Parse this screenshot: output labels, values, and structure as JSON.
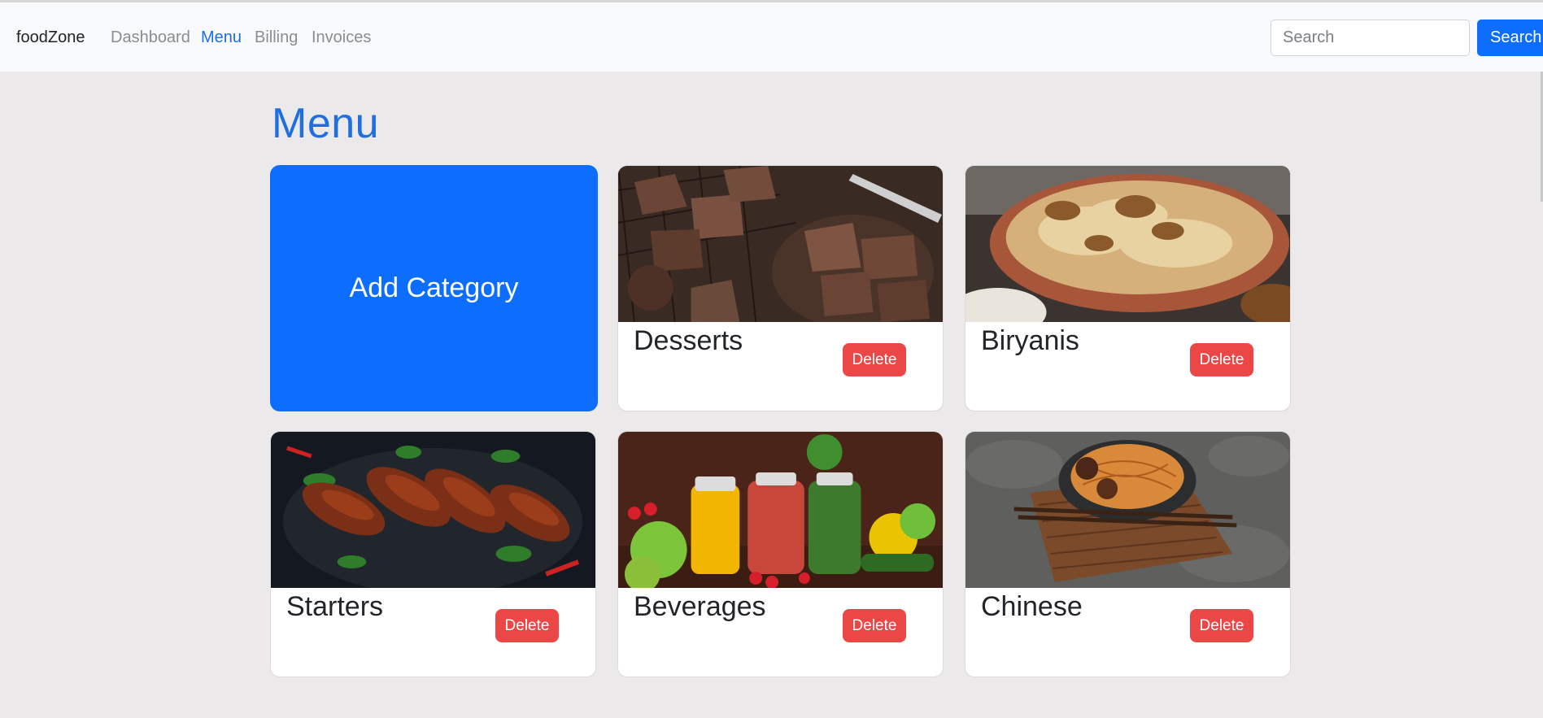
{
  "navbar": {
    "brand": "foodZone",
    "links": [
      {
        "label": "Dashboard",
        "active": false
      },
      {
        "label": "Menu",
        "active": true
      },
      {
        "label": "Billing",
        "active": false
      },
      {
        "label": "Invoices",
        "active": false
      }
    ],
    "search": {
      "placeholder": "Search",
      "value": "",
      "button_label": "Search"
    }
  },
  "page": {
    "title": "Menu",
    "add_category_label": "Add Category"
  },
  "categories": [
    {
      "name": "Desserts",
      "delete_label": "Delete",
      "image": "brownies-photo"
    },
    {
      "name": "Biryanis",
      "delete_label": "Delete",
      "image": "biryani-photo"
    },
    {
      "name": "Starters",
      "delete_label": "Delete",
      "image": "grilled-chicken-photo"
    },
    {
      "name": "Beverages",
      "delete_label": "Delete",
      "image": "juices-photo"
    },
    {
      "name": "Chinese",
      "delete_label": "Delete",
      "image": "noodles-photo"
    }
  ],
  "colors": {
    "brand_blue": "#0d6efd",
    "delete_red": "#eb4747",
    "page_bg": "#ebe9e9",
    "navbar_bg": "#f8f9fa"
  }
}
